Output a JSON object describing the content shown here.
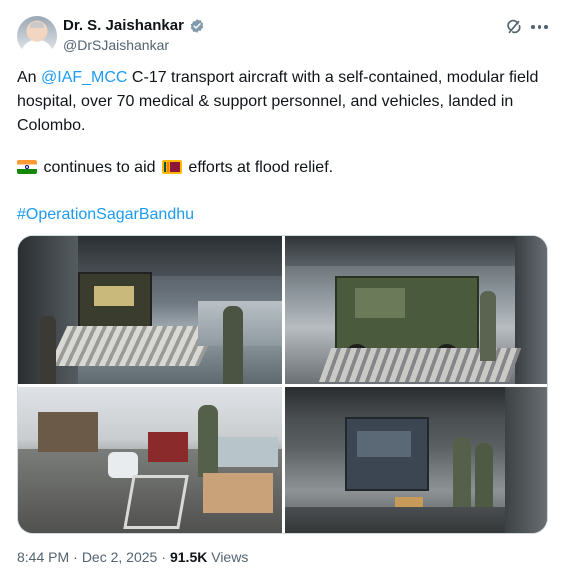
{
  "author": {
    "name": "Dr. S. Jaishankar",
    "handle": "@DrSJaishankar",
    "verified_icon": "verified-badge-icon",
    "avatar_icon": "avatar"
  },
  "post": {
    "line1_prefix": "An ",
    "mention": "@IAF_MCC",
    "line1_rest": " C-17 transport aircraft with a self-contained, modular field hospital, over 70 medical & support personnel, and vehicles, landed in Colombo.",
    "line2_part1": " continues to aid ",
    "line2_part2": " efforts at flood relief.",
    "hashtag": "#OperationSagarBandhu"
  },
  "media": {
    "count": 4
  },
  "meta": {
    "time": "8:44 PM",
    "date": "Dec 2, 2025",
    "views_count": "91.5K",
    "views_label": "Views"
  },
  "colors": {
    "link": "#1d9bf0",
    "verified": "#829aab",
    "secondary": "#536471"
  }
}
